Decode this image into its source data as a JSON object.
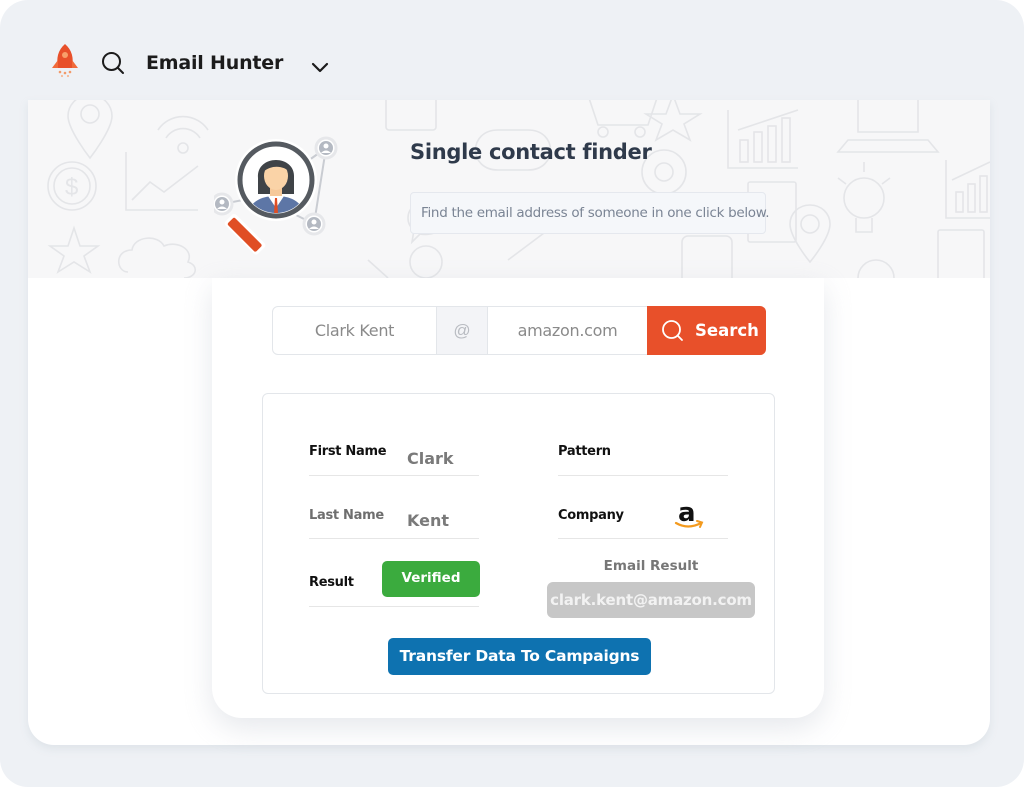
{
  "header": {
    "app_title": "Email Hunter",
    "icons": [
      "rocket-logo-icon",
      "search-icon",
      "chevron-down-icon"
    ]
  },
  "banner": {
    "title": "Single contact finder",
    "subtitle": "Find the email address of someone in one click below."
  },
  "search": {
    "name_value": "Clark Kent",
    "at_symbol": "@",
    "domain_value": "amazon.com",
    "button_label": "Search"
  },
  "result": {
    "first_name_label": "First Name",
    "first_name_value": "Clark",
    "last_name_label": "Last Name",
    "last_name_value": "Kent",
    "result_label": "Result",
    "result_value": "Verified",
    "pattern_label": "Pattern",
    "pattern_value": "",
    "company_label": "Company",
    "company_logo": "amazon-logo-icon",
    "email_result_label": "Email Result",
    "email_result_value": "clark.kent@amazon.com",
    "transfer_button_label": "Transfer Data To Campaigns"
  },
  "colors": {
    "accent_orange": "#e8502a",
    "verified_green": "#3bab3e",
    "transfer_blue": "#0e72b0",
    "email_pill_gray": "#c7c7c7",
    "frame_bg": "#eef1f5"
  }
}
